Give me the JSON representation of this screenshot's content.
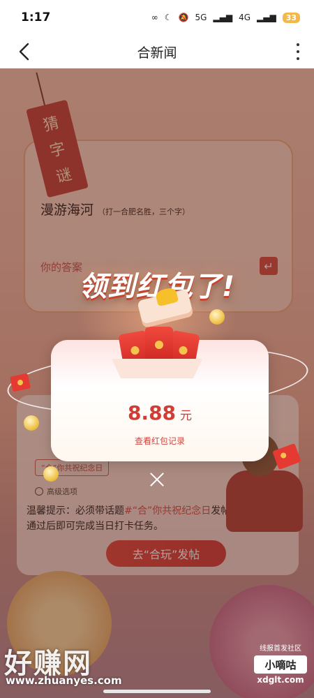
{
  "status_bar": {
    "time": "1:17",
    "network_5g": "5G",
    "network_4g": "4G",
    "battery": "33"
  },
  "header": {
    "title": "合新闻"
  },
  "riddle": {
    "tag_chars": [
      "猜",
      "字",
      "谜"
    ],
    "question": "漫游海河",
    "hint": "（打一合肥名胜，三个字）",
    "answer_placeholder": "你的答案"
  },
  "task": {
    "topic_button": "“合”你共祝纪念日",
    "advanced_label": "高级选项",
    "tip_prefix": "温馨提示：必须带话题",
    "tip_topic": "#“合”你共祝纪念日",
    "tip_suffix": "发帖，通过后即可完成当日打卡任务。",
    "post_button": "去“合玩”发帖"
  },
  "reward_popup": {
    "headline": "领到红包了!",
    "amount": "8.88",
    "unit": "元",
    "view_records": "查看红包记录"
  },
  "watermark": {
    "left_text": "好赚网",
    "left_url": "www.zhuanyes.com",
    "right_slogan": "线报首发社区",
    "right_brand": "小嘀咕",
    "right_domain": "xdglt.com"
  },
  "colors": {
    "accent_red": "#d23c34",
    "gold": "#f5c44c",
    "overlay": "rgba(70,30,25,0.42)"
  }
}
